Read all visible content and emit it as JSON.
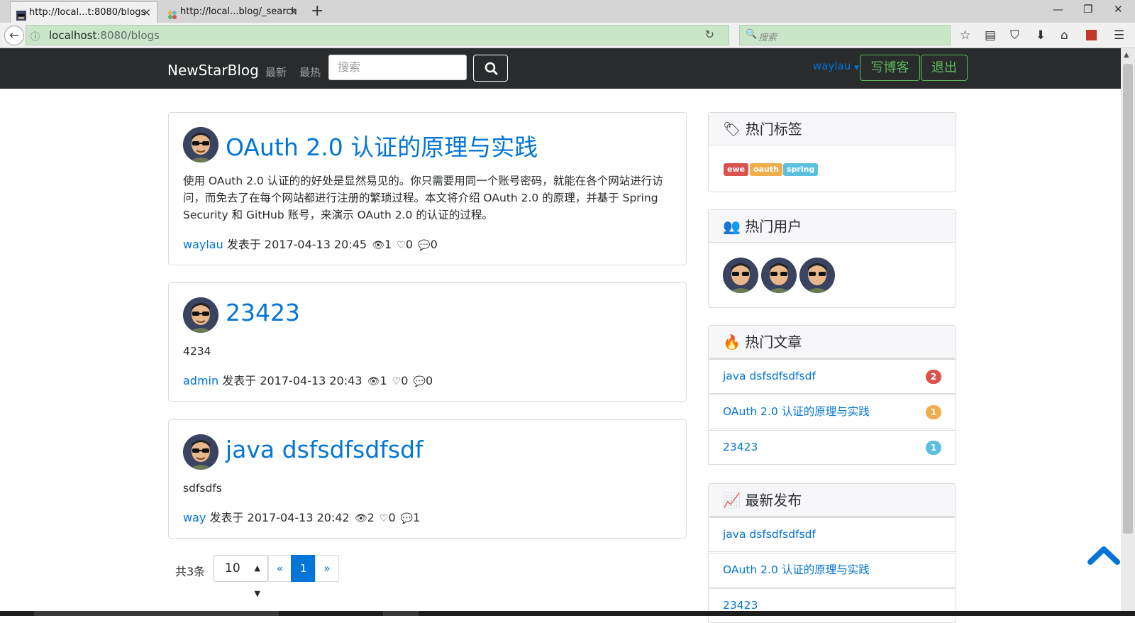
{
  "browser": {
    "tabs": [
      {
        "label": "http://local...t:8080/blogs",
        "active": true
      },
      {
        "label": "http://local...blog/_search",
        "active": false
      }
    ],
    "url_host": "localhost",
    "url_rest": ":8080/blogs",
    "search_placeholder": "搜索"
  },
  "site": {
    "brand": "NewStarBlog",
    "nav_latest": "最新",
    "nav_hot": "最热",
    "search_placeholder": "搜索",
    "username": "waylau",
    "write_label": "写博客",
    "logout_label": "退出"
  },
  "posts": [
    {
      "title": "OAuth 2.0 认证的原理与实践",
      "summary": "使用 OAuth 2.0 认证的的好处是显然易见的。你只需要用同一个账号密码，就能在各个网站进行访问，而免去了在每个网站都进行注册的繁琐过程。本文将介绍 OAuth 2.0 的原理，并基于 Spring Security 和 GitHub 账号，来演示 OAuth 2.0 的认证的过程。",
      "author": "waylau",
      "published": "发表于 2017-04-13 20:45",
      "views": "1",
      "likes": "0",
      "comments": "0"
    },
    {
      "title": "23423",
      "summary": "4234",
      "author": "admin",
      "published": "发表于 2017-04-13 20:43",
      "views": "1",
      "likes": "0",
      "comments": "0"
    },
    {
      "title": "java dsfsdfsdfsdf",
      "summary": "sdfsdfs",
      "author": "way",
      "published": "发表于 2017-04-13 20:42",
      "views": "2",
      "likes": "0",
      "comments": "1"
    }
  ],
  "pagination": {
    "total": "共3条",
    "page_size": "10",
    "prev": "«",
    "current": "1",
    "next": "»"
  },
  "sidebar": {
    "hot_tags_title": "热门标签",
    "tags": [
      {
        "label": "ewe",
        "color": "#d9534f"
      },
      {
        "label": "oauth",
        "color": "#f0ad4e"
      },
      {
        "label": "spring",
        "color": "#5bc0de"
      }
    ],
    "hot_users_title": "热门用户",
    "hot_posts_title": "热门文章",
    "hot_posts": [
      {
        "title": "java dsfsdfsdfsdf",
        "count": "2",
        "color": "#d9534f"
      },
      {
        "title": "OAuth 2.0 认证的原理与实践",
        "count": "1",
        "color": "#f0ad4e"
      },
      {
        "title": "23423",
        "count": "1",
        "color": "#5bc0de"
      }
    ],
    "new_posts_title": "最新发布",
    "new_posts": [
      "java dsfsdfsdfsdf",
      "OAuth 2.0 认证的原理与实践",
      "23423"
    ]
  },
  "colors": {
    "accent": "#0275d8",
    "navbar": "#292b2c",
    "success": "#5cb85c"
  }
}
